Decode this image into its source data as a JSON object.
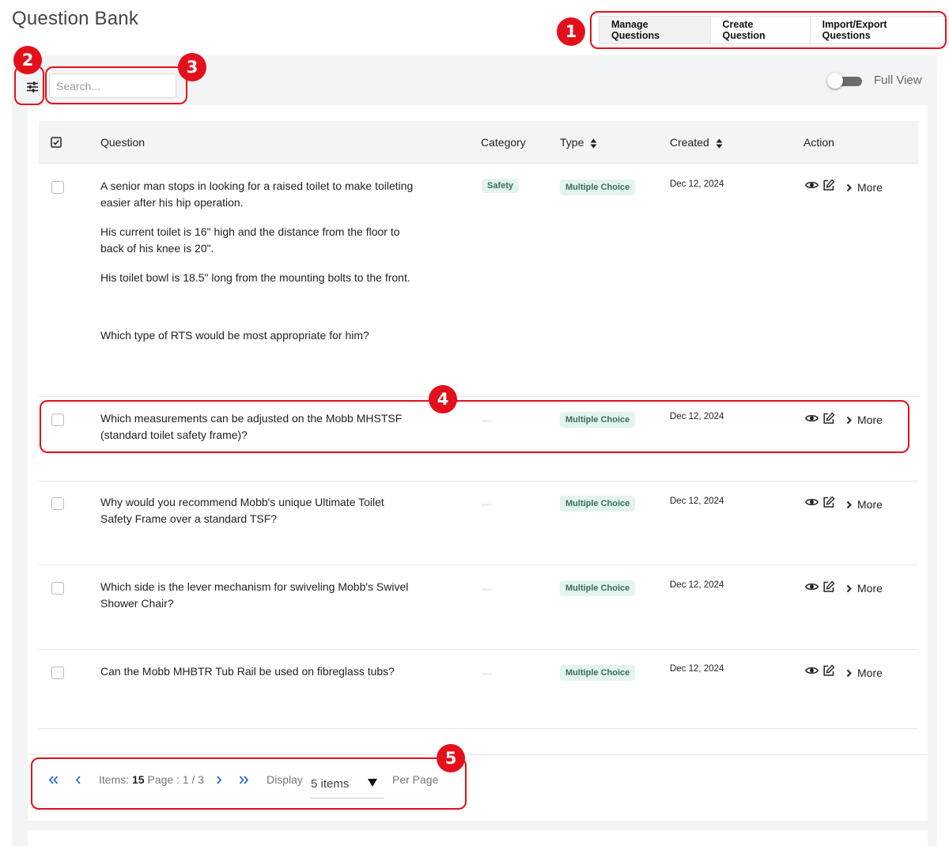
{
  "page": {
    "title": "Question Bank"
  },
  "tabs": [
    {
      "label": "Manage Questions",
      "active": true
    },
    {
      "label": "Create Question",
      "active": false
    },
    {
      "label": "Import/Export Questions",
      "active": false
    }
  ],
  "toolbar": {
    "filter_icon": "sliders-icon",
    "search_placeholder": "Search...",
    "search_value": "",
    "full_view_label": "Full View",
    "full_view_on": false
  },
  "table": {
    "columns": [
      "Question",
      "Category",
      "Type",
      "Created",
      "Action"
    ],
    "sortable_columns": [
      "Type",
      "Created"
    ],
    "more_label": "More",
    "rows": [
      {
        "question_paragraphs": [
          "A senior man stops in looking for a raised toilet to make toileting easier after his hip operation.",
          "His current toilet is 16\" high and the distance from the floor to back of his knee is 20\".",
          "His toilet bowl is 18.5\" long from the mounting bolts to the front.",
          "Which type of RTS would be most appropriate for him?"
        ],
        "category": "Safety",
        "type": "Multiple Choice",
        "created": "Dec 12, 2024"
      },
      {
        "question_paragraphs": [
          "Which measurements can be adjusted on the Mobb MHSTSF (standard toilet safety frame)?"
        ],
        "category": "",
        "type": "Multiple Choice",
        "created": "Dec 12, 2024"
      },
      {
        "question_paragraphs": [
          "Why would you recommend Mobb's unique Ultimate Toilet Safety Frame over a standard TSF?"
        ],
        "category": "",
        "type": "Multiple Choice",
        "created": "Dec 12, 2024"
      },
      {
        "question_paragraphs": [
          "Which side is the lever mechanism for swiveling Mobb's Swivel Shower Chair?"
        ],
        "category": "",
        "type": "Multiple Choice",
        "created": "Dec 12, 2024"
      },
      {
        "question_paragraphs": [
          "Can the Mobb MHBTR Tub Rail be used on fibreglass tubs?"
        ],
        "category": "",
        "type": "Multiple Choice",
        "created": "Dec 12, 2024"
      }
    ]
  },
  "pagination": {
    "items_label": "Items:",
    "items_count": "15",
    "page_label": "Page : 1 / 3",
    "display_label": "Display",
    "per_page_value": "5 items",
    "per_page_label": "Per Page"
  },
  "annotations": [
    "1",
    "2",
    "3",
    "4",
    "5"
  ],
  "colors": {
    "annotation": "#e3101b",
    "badge_bg": "#e3f4ec",
    "badge_text": "#3b6d5b",
    "pager_accent": "#2b6cd4"
  }
}
